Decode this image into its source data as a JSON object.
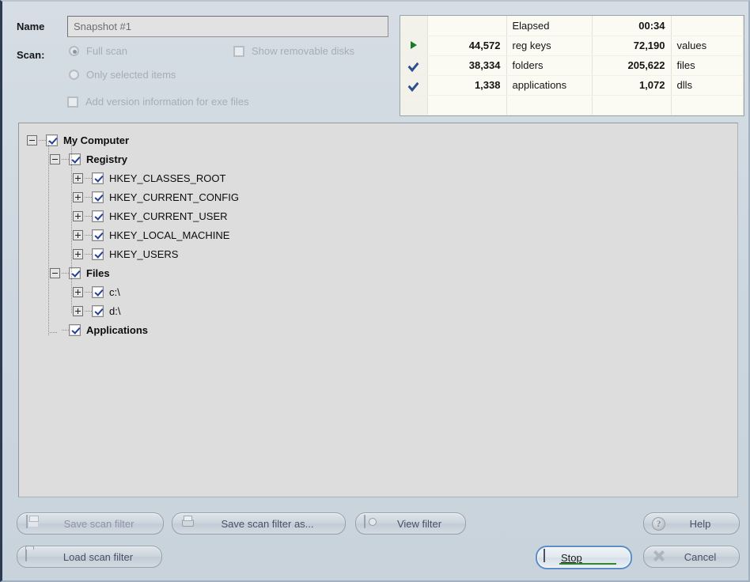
{
  "form": {
    "name_label": "Name",
    "name_value": "Snapshot #1",
    "scan_label": "Scan:",
    "options": {
      "full_scan": "Full scan",
      "only_selected": "Only selected items",
      "add_version_info": "Add version information for exe files",
      "show_removable": "Show removable disks"
    }
  },
  "stats": {
    "rows": [
      {
        "icon": "none",
        "num1": "",
        "label1": "Elapsed",
        "num2": "00:34",
        "label2": ""
      },
      {
        "icon": "play",
        "num1": "44,572",
        "label1": "reg keys",
        "num2": "72,190",
        "label2": "values"
      },
      {
        "icon": "check",
        "num1": "38,334",
        "label1": "folders",
        "num2": "205,622",
        "label2": "files"
      },
      {
        "icon": "check",
        "num1": "1,338",
        "label1": "applications",
        "num2": "1,072",
        "label2": "dlls"
      }
    ]
  },
  "tree": {
    "nodes": [
      {
        "label": "My Computer",
        "depth": 0,
        "expander": "minus",
        "bold": true,
        "checked": true
      },
      {
        "label": "Registry",
        "depth": 1,
        "expander": "minus",
        "bold": true,
        "checked": true
      },
      {
        "label": "HKEY_CLASSES_ROOT",
        "depth": 2,
        "expander": "plus",
        "bold": false,
        "checked": true
      },
      {
        "label": "HKEY_CURRENT_CONFIG",
        "depth": 2,
        "expander": "plus",
        "bold": false,
        "checked": true
      },
      {
        "label": "HKEY_CURRENT_USER",
        "depth": 2,
        "expander": "plus",
        "bold": false,
        "checked": true
      },
      {
        "label": "HKEY_LOCAL_MACHINE",
        "depth": 2,
        "expander": "plus",
        "bold": false,
        "checked": true
      },
      {
        "label": "HKEY_USERS",
        "depth": 2,
        "expander": "plus",
        "bold": false,
        "checked": true
      },
      {
        "label": "Files",
        "depth": 1,
        "expander": "minus",
        "bold": true,
        "checked": true
      },
      {
        "label": "c:\\",
        "depth": 2,
        "expander": "plus",
        "bold": false,
        "checked": true
      },
      {
        "label": "d:\\",
        "depth": 2,
        "expander": "plus",
        "bold": false,
        "checked": true
      },
      {
        "label": "Applications",
        "depth": 1,
        "expander": "none",
        "bold": true,
        "checked": true
      }
    ]
  },
  "buttons": {
    "save_scan_filter": "Save scan filter",
    "save_scan_filter_as": "Save scan filter as...",
    "view_filter": "View  filter",
    "load_scan_filter": "Load scan filter",
    "help": "Help",
    "cancel": "Cancel",
    "stop": "Stop",
    "help_glyph": "?"
  },
  "colors": {
    "window_bg": "#ccd6de",
    "tree_bg": "#dddddd",
    "stats_bg": "#fbfbf3",
    "accent_focus": "#5b8ec9",
    "progress_green": "#2f8a2f",
    "check_blue": "#21409a",
    "play_green": "#157a2b"
  }
}
